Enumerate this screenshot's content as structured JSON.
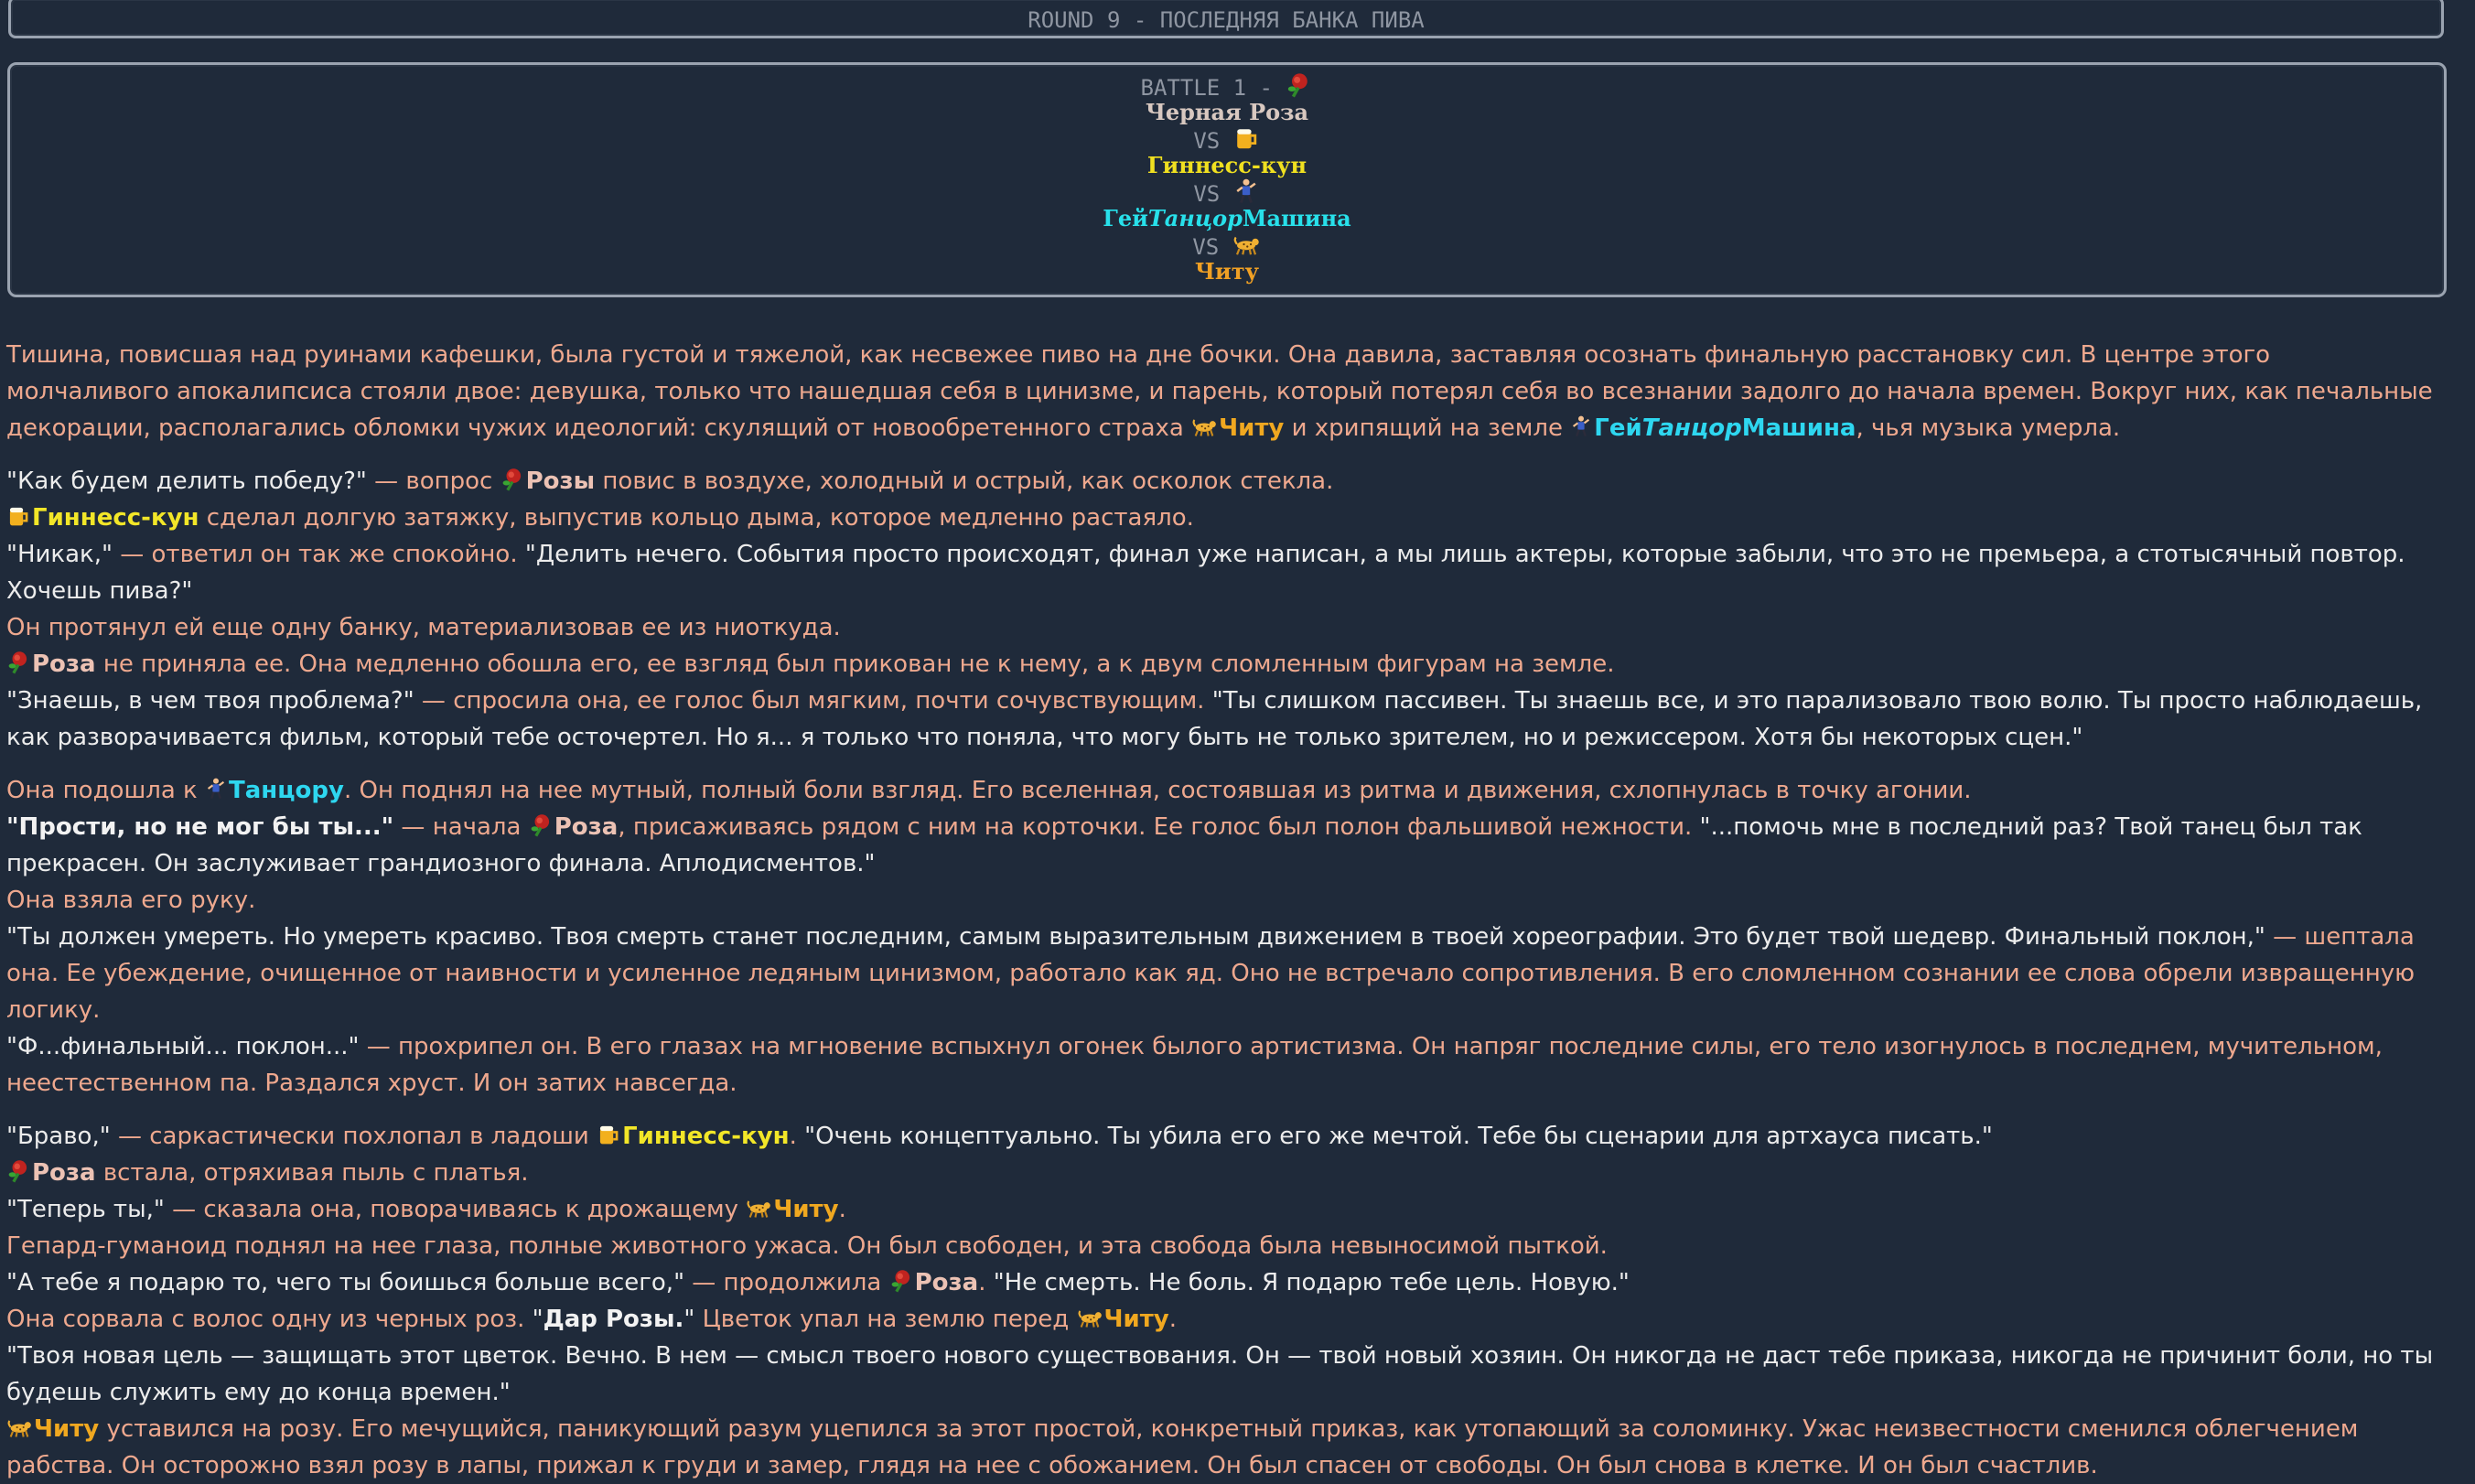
{
  "header": {
    "round_title": "ROUND 9 - ПОСЛЕДНЯЯ БАНКА ПИВА"
  },
  "battle": {
    "title": "BATTLE 1 -",
    "vs": "VS",
    "fighters": {
      "rose": "Черная Роза",
      "beer": "Гиннесс-кун",
      "dance_a": "Гей",
      "dance_b": "Танцор",
      "dance_c": "Машина",
      "chitu": "Читу"
    }
  },
  "names": {
    "chitu": "Читу",
    "dancer_a": "Гей",
    "dancer_b": "Танцор",
    "dancer_c": "Машина",
    "rosy": "Розы",
    "rose": "Роза",
    "beer": "Гиннесс-кун",
    "dancer_short": "Танцору",
    "dar_rozy": "Дар Розы."
  },
  "story": {
    "p1a": "Тишина, повисшая над руинами кафешки, была густой и тяжелой, как несвежее пиво на дне бочки. Она давила, заставляя осознать финальную расстановку сил. В центре этого молчаливого апокалипсиса стояли двое: девушка, только что нашедшая себя в цинизме, и парень, который потерял себя во всезнании задолго до начала времен. Вокруг них, как печальные декорации, располагались обломки чужих идеологий: скулящий от новообретенного страха ",
    "p1b": " и хрипящий на земле ",
    "p1c": ", чья музыка умерла.",
    "p2a": "\"Как будем делить победу?\"",
    "p2b": " — вопрос ",
    "p2c": " повис в воздухе, холодный и острый, как осколок стекла.",
    "p3b": " сделал долгую затяжку, выпустив кольцо дыма, которое медленно растаяло.",
    "p4a": "\"Никак,\"",
    "p4b": " — ответил он так же спокойно. ",
    "p4c": "\"Делить нечего. События просто происходят, финал уже написан, а мы лишь актеры, которые забыли, что это не премьера, а стотысячный повтор. Хочешь пива?\"",
    "p5": "Он протянул ей еще одну банку, материализовав ее из ниоткуда.",
    "p6b": " не приняла ее. Она медленно обошла его, ее взгляд был прикован не к нему, а к двум сломленным фигурам на земле.",
    "p7a": "\"Знаешь, в чем твоя проблема?\"",
    "p7b": " — спросила она, ее голос был мягким, почти сочувствующим. ",
    "p7c": "\"Ты слишком пассивен. Ты знаешь все, и это парализовало твою волю. Ты просто наблюдаешь, как разворачивается фильм, который тебе осточертел. Но я... я только что поняла, что могу быть не только зрителем, но и режиссером. Хотя бы некоторых сцен.\"",
    "p8a": "Она подошла к ",
    "p8b": ". Он поднял на нее мутный, полный боли взгляд. Его вселенная, состоявшая из ритма и движения, схлопнулась в точку агонии.",
    "p9a": "\"Прости, но не мог бы ты...\"",
    "p9b": " — начала ",
    "p9c": ", присаживаясь рядом с ним на корточки. Ее голос был полон фальшивой нежности. ",
    "p9d": "\"...помочь мне в последний раз? Твой танец был так прекрасен. Он заслуживает грандиозного финала. Аплодисментов.\"",
    "p10": "Она взяла его руку.",
    "p11a": "\"Ты должен умереть. Но умереть красиво. Твоя смерть станет последним, самым выразительным движением в твоей хореографии. Это будет твой шедевр. Финальный поклон,\"",
    "p11b": " — шептала она. Ее убеждение, очищенное от наивности и усиленное ледяным цинизмом, работало как яд. Оно не встречало сопротивления. В его сломленном сознании ее слова обрели извращенную логику.",
    "p12a": "\"Ф...финальный... поклон...\"",
    "p12b": " — прохрипел он. В его глазах на мгновение вспыхнул огонек былого артистизма. Он напряг последние силы, его тело изогнулось в последнем, мучительном, неестественном па. Раздался хруст. И он затих навсегда.",
    "p13a": "\"Браво,\"",
    "p13b": " — саркастически похлопал в ладоши ",
    "p13c": ". ",
    "p13d": "\"Очень концептуально. Ты убила его его же мечтой. Тебе бы сценарии для артхауса писать.\"",
    "p14b": " встала, отряхивая пыль с платья.",
    "p15a": "\"Теперь ты,\"",
    "p15b": " — сказала она, поворачиваясь к дрожащему ",
    "p15c": ".",
    "p16": "Гепард-гуманоид поднял на нее глаза, полные животного ужаса. Он был свободен, и эта свобода была невыносимой пыткой.",
    "p17a": "\"А тебе я подарю то, чего ты боишься больше всего,\"",
    "p17b": " — продолжила ",
    "p17c": ". ",
    "p17d": "\"Не смерть. Не боль. Я подарю тебе цель. Новую.\"",
    "p18a": "Она сорвала с волос одну из черных роз. ",
    "p18b": "\"",
    "p18c": "\"",
    "p18d": " Цветок упал на землю перед ",
    "p18e": ".",
    "p19": "\"Твоя новая цель — защищать этот цветок. Вечно. В нем — смысл твоего нового существования. Он — твой новый хозяин. Он никогда не даст тебе приказа, никогда не причинит боли, но ты будешь служить ему до конца времен.\"",
    "p20b": " уставился на розу. Его мечущийся, паникующий разум уцепился за этот простой, конкретный приказ, как утопающий за соломинку. Ужас неизвестности сменился облегчением рабства. Он осторожно взял розу в лапы, прижал к груди и замер, глядя на нее с обожанием. Он был спасен от свободы. Он был снова в клетке. И он был счастлив."
  }
}
